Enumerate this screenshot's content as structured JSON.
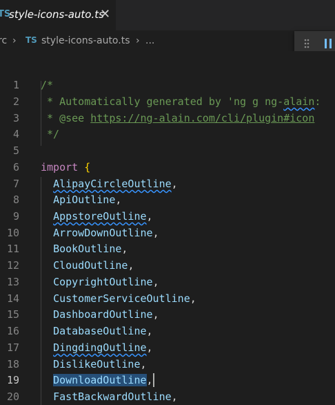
{
  "tab": {
    "lang_badge": "TS",
    "title": "style-icons-auto.ts",
    "close_glyph": "✕"
  },
  "breadcrumb": {
    "folder": "rc",
    "sep": "›",
    "lang_badge": "TS",
    "file": "style-icons-auto.ts",
    "more": "..."
  },
  "debug_toolbar": {
    "grip_icon": "grip-dots-icon",
    "pause_icon": "pause-icon"
  },
  "editor": {
    "active_line": 19,
    "lines": [
      {
        "n": "1",
        "text": "/*"
      },
      {
        "n": "2",
        "text": " * Automatically generated by 'ng g ng-alain:"
      },
      {
        "n": "3",
        "text": " * @see https://ng-alain.com/cli/plugin#icon"
      },
      {
        "n": "4",
        "text": " */"
      },
      {
        "n": "5",
        "text": ""
      },
      {
        "n": "6",
        "text": "import {"
      },
      {
        "n": "7",
        "text": "  AlipayCircleOutline,"
      },
      {
        "n": "8",
        "text": "  ApiOutline,"
      },
      {
        "n": "9",
        "text": "  AppstoreOutline,"
      },
      {
        "n": "10",
        "text": "  ArrowDownOutline,"
      },
      {
        "n": "11",
        "text": "  BookOutline,"
      },
      {
        "n": "12",
        "text": "  CloudOutline,"
      },
      {
        "n": "13",
        "text": "  CopyrightOutline,"
      },
      {
        "n": "14",
        "text": "  CustomerServiceOutline,"
      },
      {
        "n": "15",
        "text": "  DashboardOutline,"
      },
      {
        "n": "16",
        "text": "  DatabaseOutline,"
      },
      {
        "n": "17",
        "text": "  DingdingOutline,"
      },
      {
        "n": "18",
        "text": "  DislikeOutline,"
      },
      {
        "n": "19",
        "text": "  DownloadOutline,"
      },
      {
        "n": "20",
        "text": "  FastBackwardOutline,"
      }
    ],
    "comment_parts": {
      "l2_a": " * Automatically generated by 'ng g ng-",
      "l2_b": "alain",
      "l2_c": ":",
      "l3_a": " * @see ",
      "l3_link": "https://ng-alain.com/cli/plugin#icon"
    },
    "imports": {
      "keyword": "import",
      "brace": "{",
      "names": [
        "AlipayCircleOutline",
        "ApiOutline",
        "AppstoreOutline",
        "ArrowDownOutline",
        "BookOutline",
        "CloudOutline",
        "CopyrightOutline",
        "CustomerServiceOutline",
        "DashboardOutline",
        "DatabaseOutline",
        "DingdingOutline",
        "DislikeOutline",
        "DownloadOutline",
        "FastBackwardOutline"
      ],
      "comma": ","
    }
  }
}
